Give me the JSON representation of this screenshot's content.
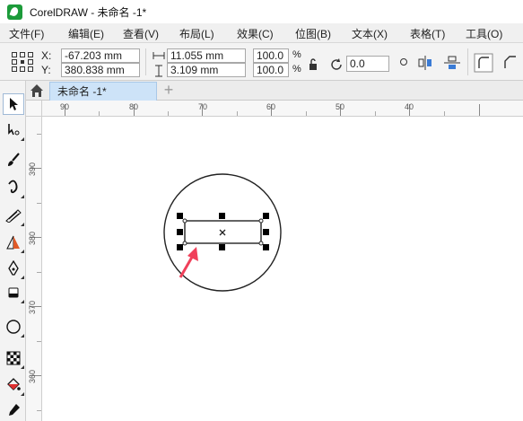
{
  "window": {
    "title": "CorelDRAW - 未命名 -1*"
  },
  "menu": [
    "文件(F)",
    "编辑(E)",
    "查看(V)",
    "布局(L)",
    "效果(C)",
    "位图(B)",
    "文本(X)",
    "表格(T)",
    "工具(O)"
  ],
  "properties": {
    "x_label": "X:",
    "x_value": "-67.203 mm",
    "y_label": "Y:",
    "y_value": "380.838 mm",
    "width_value": "11.055 mm",
    "height_value": "3.109 mm",
    "scale_x": "100.0",
    "scale_y": "100.0",
    "percent": "%",
    "rotation": "0.0"
  },
  "document": {
    "tab_label": "未命名 -1*",
    "add_tab": "+"
  },
  "rulers": {
    "horizontal": [
      "90",
      "80",
      "70",
      "60",
      "50",
      "40"
    ],
    "vertical": [
      "390",
      "380",
      "370",
      "360"
    ]
  },
  "tools": [
    "pick-tool",
    "shape-tool",
    "artistic-media-tool",
    "freehand-tool",
    "smart-fill-tool",
    "dimension-tool",
    "pen-tool",
    "eraser-tool",
    "ellipse-tool",
    "pattern-fill-tool",
    "interactive-fill-tool",
    "color-eyedropper-tool"
  ],
  "colors": {
    "accent": "#cde3f8",
    "arrow": "#f0405a",
    "app": "#1c9b3a"
  }
}
